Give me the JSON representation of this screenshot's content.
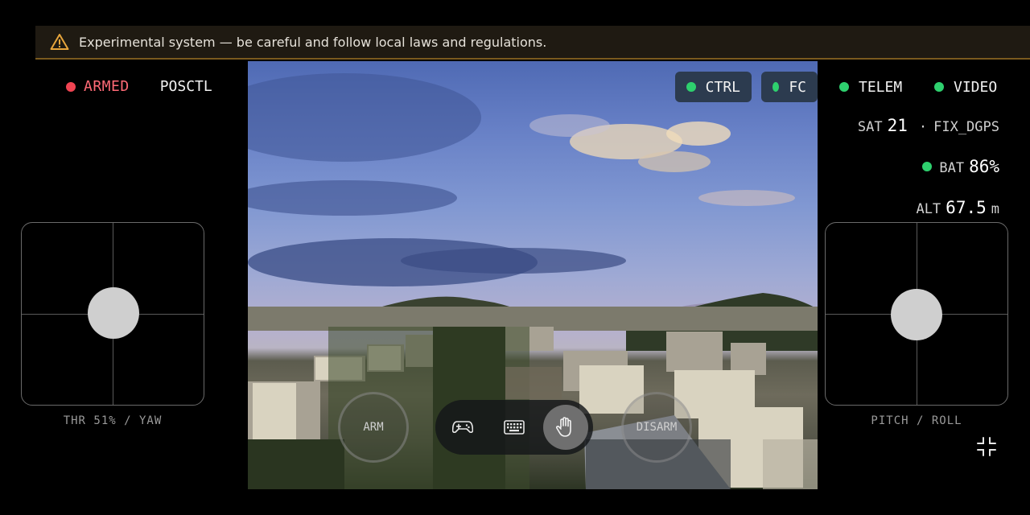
{
  "banner": {
    "icon": "warning-icon",
    "text": "Experimental system — be careful and follow local laws and regulations.",
    "color": "#7a5a1e"
  },
  "status": {
    "armed_label": "ARMED",
    "mode": "POSCTL",
    "armed_color": "#f04452"
  },
  "links": [
    {
      "label": "CTRL",
      "state": "ok"
    },
    {
      "label": "FC",
      "state": "ok"
    },
    {
      "label": "TELEM",
      "state": "ok"
    },
    {
      "label": "VIDEO",
      "state": "ok"
    }
  ],
  "telemetry": {
    "sat_label": "SAT",
    "sat_value": "21",
    "separator": "·",
    "fix": "FIX_DGPS",
    "bat_label": "BAT",
    "bat_value": "86%",
    "alt_label": "ALT",
    "alt_value": "67.5",
    "alt_unit": "m"
  },
  "left_stick": {
    "label": "THR 51% / YAW",
    "throttle": 0.51
  },
  "right_stick": {
    "label": "PITCH / ROLL"
  },
  "buttons": {
    "arm": "ARM",
    "disarm": "DISARM"
  },
  "toolbar": {
    "items": [
      "gamepad-icon",
      "keyboard-icon",
      "hand-icon"
    ],
    "active": "hand-icon"
  },
  "collapse": {
    "icon": "collapse-icon"
  },
  "colors": {
    "ok": "#2ed06e",
    "accent": "#2c3b4f"
  }
}
